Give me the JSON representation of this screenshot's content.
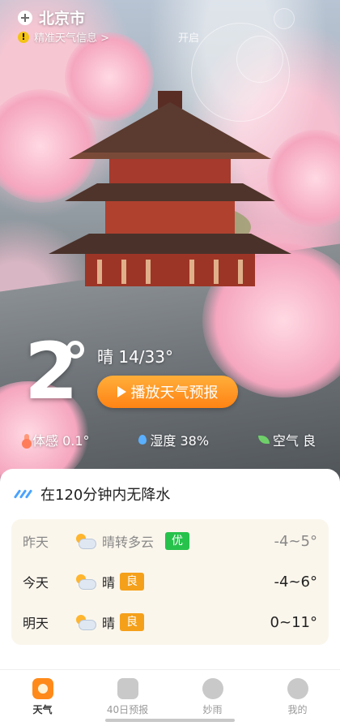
{
  "location": {
    "city": "北京市"
  },
  "notice": {
    "text": "精准天气信息 >",
    "action": "开启"
  },
  "current": {
    "temperature": "2",
    "condition_range": "晴 14/33°",
    "play_button": "播放天气预报"
  },
  "stats": [
    {
      "icon": "thermometer-icon",
      "label": "体感 0.1°"
    },
    {
      "icon": "water-drop-icon",
      "label": "湿度 38%"
    },
    {
      "icon": "leaf-icon",
      "label": "空气 良"
    }
  ],
  "rain": {
    "text": "在120分钟内无降水"
  },
  "forecast": [
    {
      "day": "昨天",
      "condition": "晴转多云",
      "aqi": "优",
      "aqi_color": "#27c24c",
      "range": "-4~5°"
    },
    {
      "day": "今天",
      "condition": "晴",
      "aqi": "良",
      "aqi_color": "#f5a01a",
      "range": "-4~6°"
    },
    {
      "day": "明天",
      "condition": "晴",
      "aqi": "良",
      "aqi_color": "#f5a01a",
      "range": "0~11°"
    }
  ],
  "tabs": [
    {
      "label": "天气",
      "icon": "sun-icon",
      "active": true
    },
    {
      "label": "40日预报",
      "icon": "calendar-icon",
      "active": false
    },
    {
      "label": "妙雨",
      "icon": "cloud-rain-icon",
      "active": false
    },
    {
      "label": "我的",
      "icon": "profile-icon",
      "active": false
    }
  ],
  "colors": {
    "accent": "#ff8a1a",
    "good": "#27c24c",
    "moderate": "#f5a01a"
  }
}
